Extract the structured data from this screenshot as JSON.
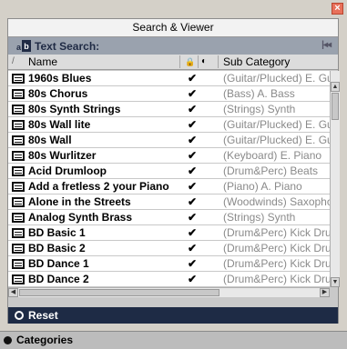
{
  "window": {
    "close_symbol": "×"
  },
  "panel": {
    "title": "Search & Viewer",
    "search_label": "Text Search:",
    "collapse_symbol": "|◂◂"
  },
  "columns": {
    "sort_indicator": "/",
    "name": "Name",
    "lock": "🔒",
    "col3": "◐",
    "sub_category": "Sub Category"
  },
  "rows": [
    {
      "name": "1960s Blues",
      "checked": "✔",
      "sub": "(Guitar/Plucked) E. Guitar"
    },
    {
      "name": "80s Chorus",
      "checked": "✔",
      "sub": "(Bass) A. Bass"
    },
    {
      "name": "80s Synth Strings",
      "checked": "✔",
      "sub": "(Strings) Synth"
    },
    {
      "name": "80s Wall lite",
      "checked": "✔",
      "sub": "(Guitar/Plucked) E. Guitar"
    },
    {
      "name": "80s Wall",
      "checked": "✔",
      "sub": "(Guitar/Plucked) E. Guitar"
    },
    {
      "name": "80s Wurlitzer",
      "checked": "✔",
      "sub": "(Keyboard) E. Piano"
    },
    {
      "name": "Acid Drumloop",
      "checked": "✔",
      "sub": "(Drum&Perc) Beats"
    },
    {
      "name": "Add a fretless 2 your Piano",
      "checked": "✔",
      "sub": "(Piano) A. Piano"
    },
    {
      "name": "Alone in the Streets",
      "checked": "✔",
      "sub": "(Woodwinds) Saxophone"
    },
    {
      "name": "Analog Synth Brass",
      "checked": "✔",
      "sub": "(Strings) Synth"
    },
    {
      "name": "BD Basic 1",
      "checked": "✔",
      "sub": "(Drum&Perc) Kick Drum"
    },
    {
      "name": "BD Basic 2",
      "checked": "✔",
      "sub": "(Drum&Perc) Kick Drum"
    },
    {
      "name": "BD Dance 1",
      "checked": "✔",
      "sub": "(Drum&Perc) Kick Drum"
    },
    {
      "name": "BD Dance 2",
      "checked": "✔",
      "sub": "(Drum&Perc) Kick Drum"
    }
  ],
  "scroll": {
    "up": "▲",
    "down": "▼",
    "left": "◀",
    "right": "▶"
  },
  "reset_label": "Reset",
  "categories_label": "Categories",
  "colors": {
    "header_bar": "#1e2b45",
    "search_row": "#9aa2ae",
    "close": "#e8705a"
  }
}
